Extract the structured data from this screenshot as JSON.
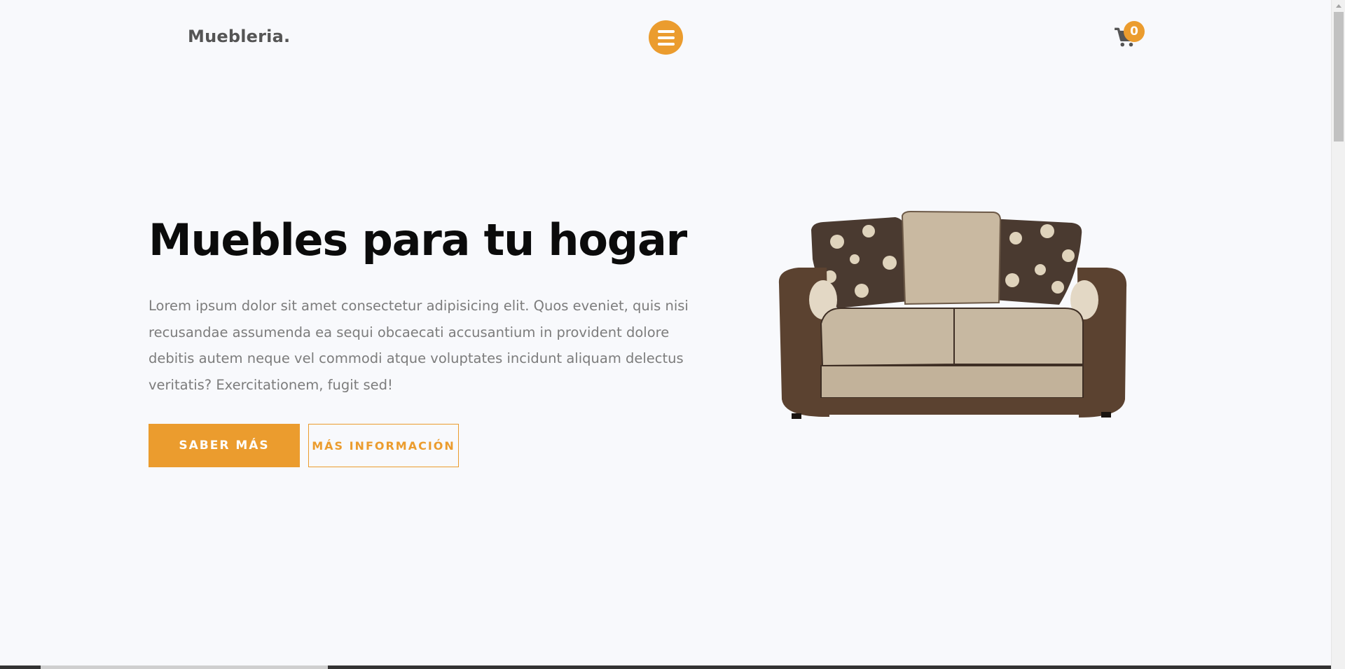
{
  "header": {
    "logo": "Muebleria.",
    "cart_count": "0"
  },
  "hero": {
    "title": "Muebles para tu hogar",
    "description": "Lorem ipsum dolor sit amet consectetur adipisicing elit. Quos eveniet, quis nisi recusandae assumenda ea sequi obcaecati accusantium in provident dolore debitis autem neque vel commodi atque voluptates incidunt aliquam delectus veritatis? Exercitationem, fugit sed!",
    "primary_button": "SABER MÁS",
    "secondary_button": "MÁS INFORMACIÓN"
  },
  "icons": {
    "menu": "hamburger-menu-icon",
    "cart": "shopping-cart-icon"
  },
  "colors": {
    "accent": "#eb9c2e",
    "background": "#f8f9fc",
    "title": "#0b0b0b",
    "body_text": "#7c7c7c"
  }
}
